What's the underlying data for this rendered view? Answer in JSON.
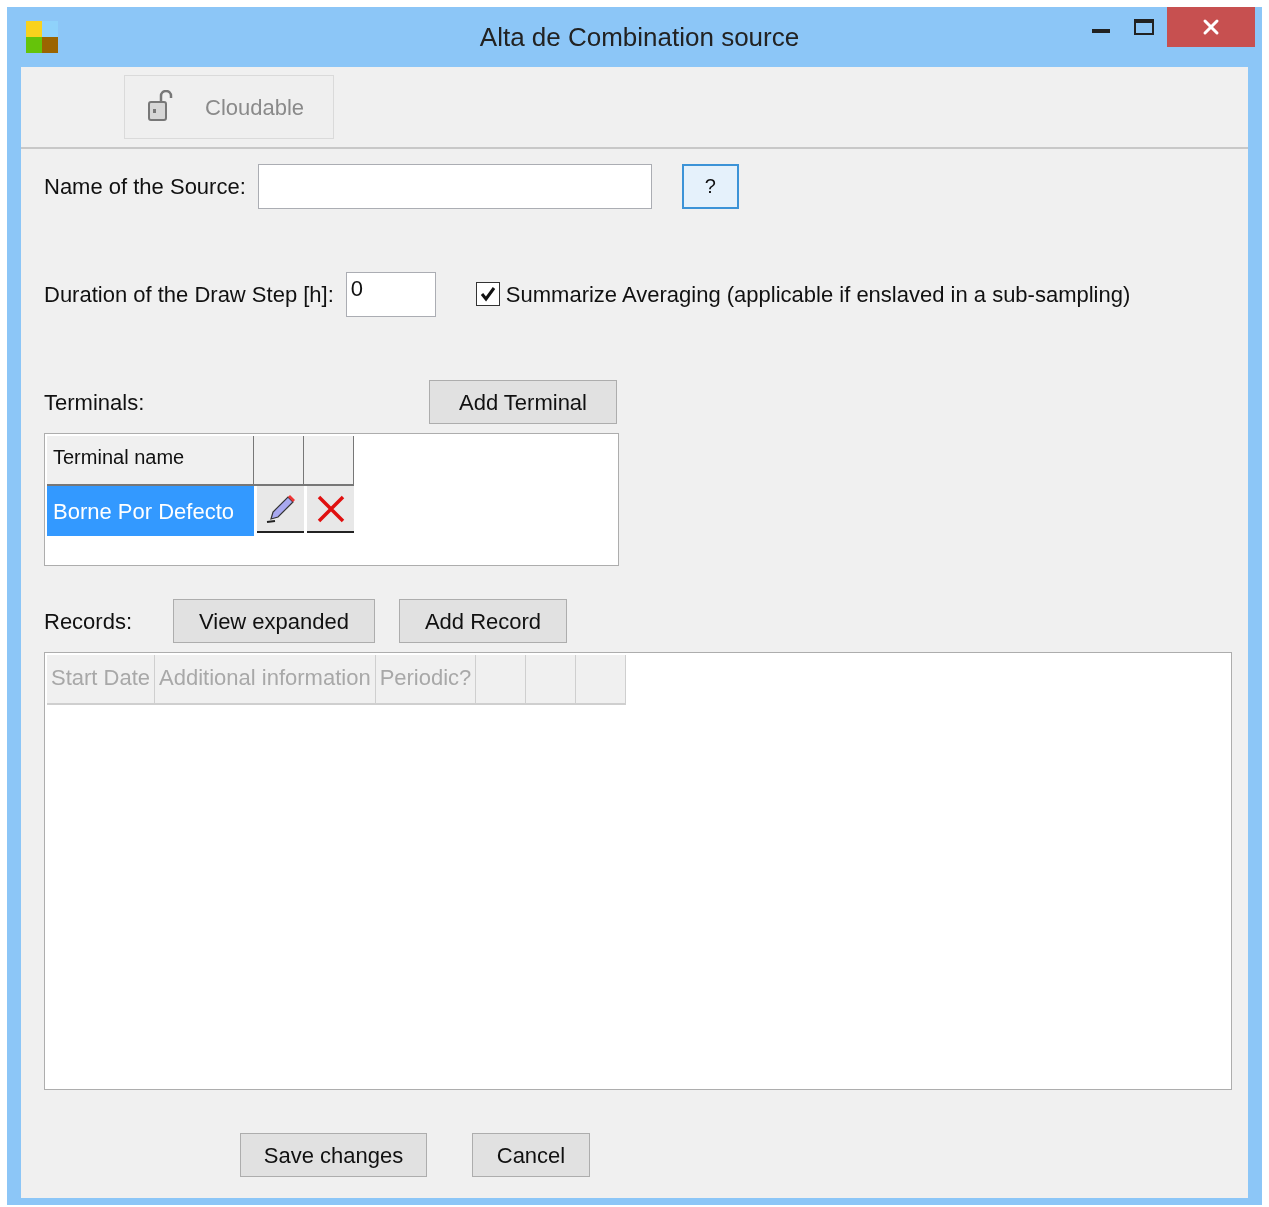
{
  "window": {
    "title": "Alta de Combination source"
  },
  "toolbar": {
    "cloudable": {
      "label": "Cloudable",
      "disabled": true
    }
  },
  "name_field": {
    "label": "Name of the Source:",
    "help_button": "?"
  },
  "duration_field": {
    "label": "Duration of the Draw Step [h]:",
    "value": "0"
  },
  "summarize": {
    "label": "Summarize Averaging (applicable if enslaved in a sub-sampling)",
    "checked": true
  },
  "terminals": {
    "label": "Terminals:",
    "add_button": "Add Terminal",
    "columns": [
      "Terminal name"
    ],
    "rows": [
      {
        "name": "Borne Por Defecto",
        "selected": true
      }
    ]
  },
  "records": {
    "label": "Records:",
    "view_button": "View expanded",
    "add_button": "Add Record",
    "columns": [
      "Start Date",
      "Additional information",
      "Periodic?"
    ],
    "disabled": true
  },
  "buttons": {
    "save": "Save changes",
    "cancel": "Cancel"
  }
}
